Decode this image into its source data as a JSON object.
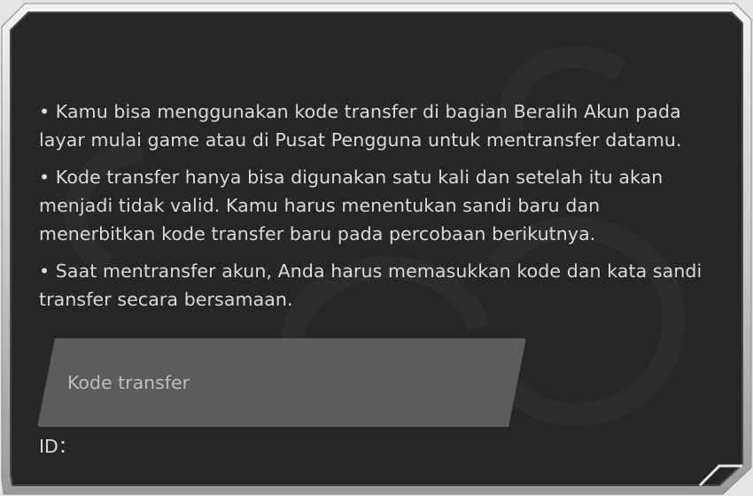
{
  "dialog": {
    "paragraphs": [
      "• Kamu bisa menggunakan kode transfer di bagian Beralih Akun pada layar mulai game atau di Pusat Pengguna untuk mentransfer datamu.",
      "• Kode transfer hanya bisa digunakan satu kali dan setelah itu akan menjadi tidak valid. Kamu harus menentukan sandi baru dan menerbitkan kode transfer baru pada percobaan berikutnya.",
      "• Saat mentransfer akun, Anda harus memasukkan kode dan kata sandi transfer secara bersamaan."
    ],
    "code_input": {
      "placeholder": "Kode transfer",
      "value": ""
    },
    "id_label": "ID："
  },
  "colors": {
    "panel_background": "#262626",
    "frame_outer": "#bfbfbf",
    "input_background": "#5c5c5c",
    "text": "#d9d9d9",
    "placeholder_text": "#bdbdbd"
  }
}
